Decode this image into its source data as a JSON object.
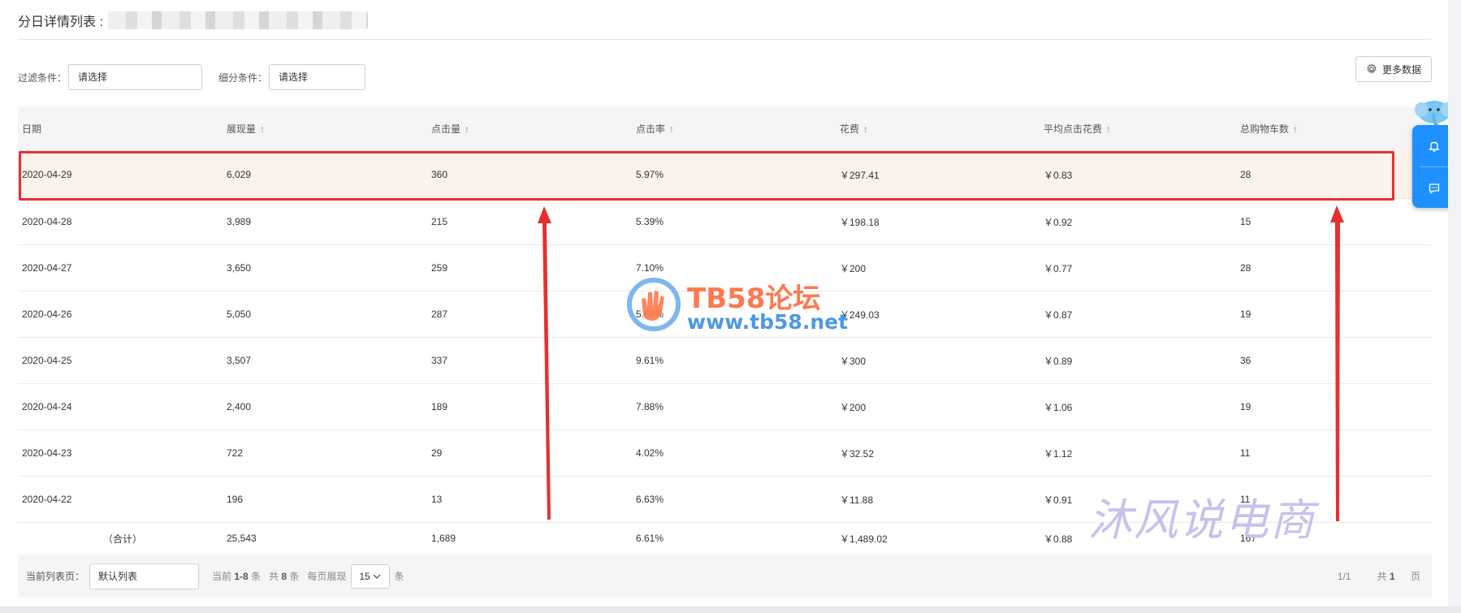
{
  "title": "分日详情列表 :",
  "filters": {
    "filter_label": "过滤条件：",
    "filter_value": "请选择",
    "segment_label": "细分条件：",
    "segment_value": "请选择"
  },
  "more_button": "更多数据",
  "table": {
    "headers": [
      {
        "label": "日期",
        "sortable": false
      },
      {
        "label": "展现量",
        "sortable": true
      },
      {
        "label": "点击量",
        "sortable": true
      },
      {
        "label": "点击率",
        "sortable": true
      },
      {
        "label": "花费",
        "sortable": true
      },
      {
        "label": "平均点击花费",
        "sortable": true
      },
      {
        "label": "总购物车数",
        "sortable": true
      }
    ],
    "sort_arrow": "↑",
    "rows": [
      [
        "2020-04-29",
        "6,029",
        "360",
        "5.97%",
        "￥297.41",
        "￥0.83",
        "28"
      ],
      [
        "2020-04-28",
        "3,989",
        "215",
        "5.39%",
        "￥198.18",
        "￥0.92",
        "15"
      ],
      [
        "2020-04-27",
        "3,650",
        "259",
        "7.10%",
        "￥200",
        "￥0.77",
        "28"
      ],
      [
        "2020-04-26",
        "5,050",
        "287",
        "5.68%",
        "￥249.03",
        "￥0.87",
        "19"
      ],
      [
        "2020-04-25",
        "3,507",
        "337",
        "9.61%",
        "￥300",
        "￥0.89",
        "36"
      ],
      [
        "2020-04-24",
        "2,400",
        "189",
        "7.88%",
        "￥200",
        "￥1.06",
        "19"
      ],
      [
        "2020-04-23",
        "722",
        "29",
        "4.02%",
        "￥32.52",
        "￥1.12",
        "11"
      ],
      [
        "2020-04-22",
        "196",
        "13",
        "6.63%",
        "￥11.88",
        "￥0.91",
        "11"
      ]
    ],
    "total": [
      "（合计）",
      "25,543",
      "1,689",
      "6.61%",
      "￥1,489.02",
      "￥0.88",
      "167"
    ]
  },
  "footer": {
    "current_label": "当前列表页：",
    "current_value": "默认列表",
    "range_prefix": "当前",
    "range_value": "1-8",
    "range_suffix": "条",
    "count_prefix": "共",
    "count_value": "8",
    "count_suffix": "条",
    "page_size_label": "每页展现",
    "page_size_value": "15",
    "page_size_suffix": "条",
    "page_indicator": "1/1",
    "pages_prefix": "共",
    "pages_value": "1",
    "pages_suffix": "页"
  },
  "watermark": {
    "brand": "TB58论坛",
    "url": "www.tb58.net",
    "author": "沐风说电商"
  },
  "colors": {
    "highlight_border": "#e53030",
    "highlight_bg": "#fbf2eb",
    "side_panel": "#1e90ff",
    "annotation_arrow": "#e53030"
  },
  "icons": {
    "more": "gear-icon",
    "bell": "bell-icon",
    "chat": "chat-icon",
    "dropdown": "chevron-down-icon"
  }
}
